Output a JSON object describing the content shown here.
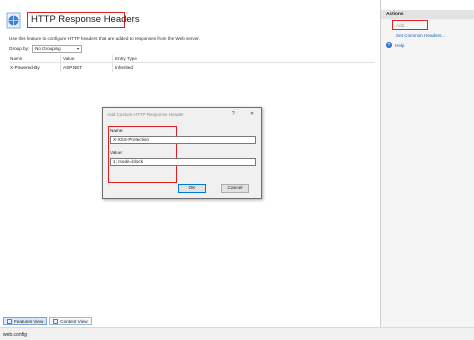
{
  "feature": {
    "title": "HTTP Response Headers",
    "description": "Use this feature to configure HTTP headers that are added to responses from the Web server.",
    "group_by_label": "Group by:",
    "group_by_value": "No Grouping"
  },
  "grid": {
    "columns": [
      "Name",
      "Value",
      "Entry Type"
    ],
    "rows": [
      {
        "name": "X-Powered-By",
        "value": "ASP.NET",
        "entry_type": "Inherited"
      }
    ]
  },
  "tabs": {
    "features_view": "Features View",
    "content_view": "Content View"
  },
  "actions": {
    "header": "Actions",
    "add": "Add...",
    "set_common": "Set Common Headers...",
    "help": "Help"
  },
  "dialog": {
    "title": "Add Custom HTTP Response Header",
    "help_glyph": "?",
    "close_glyph": "✕",
    "name_label": "Name:",
    "name_value": "X-XSS-Protection",
    "value_label": "Value:",
    "value_value": "1; mode=block",
    "ok": "OK",
    "cancel": "Cancel"
  },
  "status": {
    "text": "web.config"
  },
  "colors": {
    "highlight": "#e02020",
    "link": "#1a5fb4"
  }
}
